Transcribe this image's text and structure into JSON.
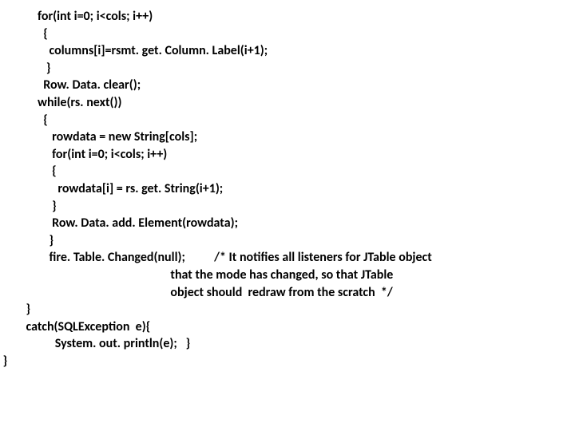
{
  "lines": {
    "l1": "             for(int i=0; i<cols; i++)",
    "l2": "               {",
    "l3": "                 columns[i]=rsmt. get. Column. Label(i+1);",
    "l4": "                }",
    "l5": "               Row. Data. clear();",
    "l6": "             while(rs. next())",
    "l7": "               {",
    "l8": "                  rowdata = new String[cols];",
    "l9": "                  for(int i=0; i<cols; i++)",
    "l10": "                  {",
    "l11": "                    rowdata[i] = rs. get. String(i+1);",
    "l12": "                  }",
    "l13": "                  Row. Data. add. Element(rowdata);",
    "l14": "                 }",
    "l15": "                 fire. Table. Changed(null);          /* It notifies all listeners for JTable object",
    "l16": "                                                           that the mode has changed, so that JTable",
    "l17": "                                                           object should  redraw from the scratch  */",
    "l18": "         }",
    "l19": "         catch(SQLException  e){",
    "l20": "                   System. out. println(e);   }",
    "l21": " }"
  }
}
